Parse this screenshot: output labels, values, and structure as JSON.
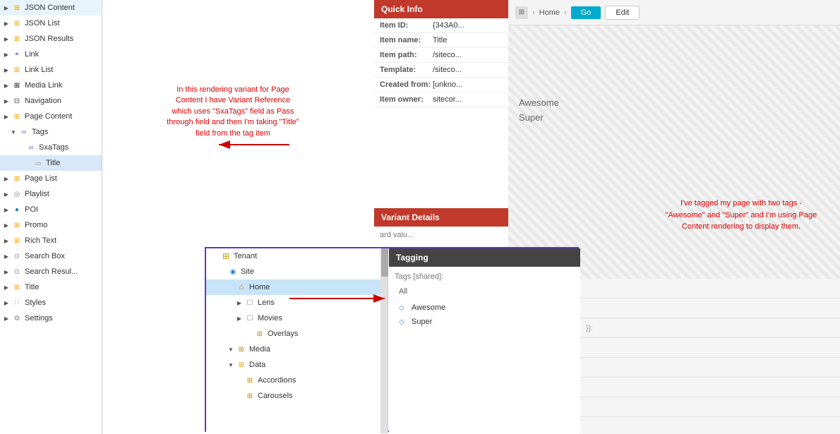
{
  "leftPanel": {
    "items": [
      {
        "id": "json-content",
        "label": "JSON Content",
        "icon": "⊞",
        "indent": 0,
        "hasArrow": true
      },
      {
        "id": "json-list",
        "label": "JSON List",
        "icon": "⊞",
        "indent": 0,
        "hasArrow": true
      },
      {
        "id": "json-results",
        "label": "JSON Results",
        "icon": "⊞",
        "indent": 0,
        "hasArrow": true
      },
      {
        "id": "link",
        "label": "Link",
        "icon": "⚭",
        "indent": 0,
        "hasArrow": true
      },
      {
        "id": "link-list",
        "label": "Link List",
        "icon": "⊞",
        "indent": 0,
        "hasArrow": true
      },
      {
        "id": "media-link",
        "label": "Media Link",
        "icon": "⊞",
        "indent": 0,
        "hasArrow": true
      },
      {
        "id": "navigation",
        "label": "Navigation",
        "icon": "⊟",
        "indent": 0,
        "hasArrow": true
      },
      {
        "id": "page-content",
        "label": "Page Content",
        "icon": "⊞",
        "indent": 0,
        "hasArrow": true
      },
      {
        "id": "tags",
        "label": "Tags",
        "icon": "∞",
        "indent": 1,
        "hasArrow": true,
        "isSelected": false
      },
      {
        "id": "sxatags",
        "label": "SxaTags",
        "icon": "∞",
        "indent": 2,
        "hasArrow": false
      },
      {
        "id": "title-child",
        "label": "Title",
        "icon": "▭",
        "indent": 3,
        "hasArrow": false
      },
      {
        "id": "page-list",
        "label": "Page List",
        "icon": "⊞",
        "indent": 0,
        "hasArrow": true
      },
      {
        "id": "playlist",
        "label": "Playlist",
        "icon": "◎",
        "indent": 0,
        "hasArrow": true
      },
      {
        "id": "poi",
        "label": "POI",
        "icon": "●",
        "indent": 0,
        "hasArrow": true
      },
      {
        "id": "promo",
        "label": "Promo",
        "icon": "⊞",
        "indent": 0,
        "hasArrow": true
      },
      {
        "id": "rich-text",
        "label": "Rich Text",
        "icon": "⊞",
        "indent": 0,
        "hasArrow": true
      },
      {
        "id": "search-box",
        "label": "Search Box",
        "icon": "⊙",
        "indent": 0,
        "hasArrow": true
      },
      {
        "id": "search-results",
        "label": "Search Resul...",
        "icon": "⊙",
        "indent": 0,
        "hasArrow": true
      },
      {
        "id": "title",
        "label": "Title",
        "icon": "⊞",
        "indent": 0,
        "hasArrow": true
      },
      {
        "id": "styles",
        "label": "Styles",
        "icon": "∷",
        "indent": 0,
        "hasArrow": true
      },
      {
        "id": "settings",
        "label": "Settings",
        "icon": "⚙",
        "indent": 0,
        "hasArrow": true
      }
    ]
  },
  "annotation": {
    "text": "In this rendering variant for Page Content I have Variant Reference which uses \"SxaTags\" field as Pass through field and then I'm taking \"Title\" field from the tag item"
  },
  "overlayTree": {
    "items": [
      {
        "id": "tenant",
        "label": "Tenant",
        "icon": "⊞",
        "indent": 0,
        "hasArrow": false
      },
      {
        "id": "site",
        "label": "Site",
        "icon": "◉",
        "indent": 1,
        "hasArrow": false
      },
      {
        "id": "home",
        "label": "Home",
        "icon": "⌂",
        "indent": 2,
        "hasArrow": false,
        "isSelected": true
      },
      {
        "id": "lens",
        "label": "Lens",
        "icon": "☐",
        "indent": 3,
        "hasArrow": true
      },
      {
        "id": "movies",
        "label": "Movies",
        "icon": "☐",
        "indent": 3,
        "hasArrow": true
      },
      {
        "id": "overlays",
        "label": "Overlays",
        "icon": "⊞",
        "indent": 4,
        "hasArrow": false
      },
      {
        "id": "media",
        "label": "Media",
        "icon": "⊞",
        "indent": 2,
        "hasArrow": true
      },
      {
        "id": "data",
        "label": "Data",
        "icon": "⊞",
        "indent": 2,
        "hasArrow": true
      },
      {
        "id": "accordions",
        "label": "Accordions",
        "icon": "⊞",
        "indent": 3,
        "hasArrow": false
      },
      {
        "id": "carousels",
        "label": "Carousels",
        "icon": "⊞",
        "indent": 3,
        "hasArrow": false
      }
    ]
  },
  "tagging": {
    "header": "Tagging",
    "label": "Tags",
    "labelSuffix": "[shared]:",
    "allText": "All",
    "tags": [
      {
        "label": "Awesome",
        "icon": "◇"
      },
      {
        "label": "Super",
        "icon": "◇"
      }
    ]
  },
  "quickInfo": {
    "header": "Quick Info",
    "rows": [
      {
        "key": "Item ID:",
        "value": "{343A0..."
      },
      {
        "key": "Item name:",
        "value": "Title"
      },
      {
        "key": "Item path:",
        "value": "/siteco..."
      },
      {
        "key": "Template:",
        "value": "/siteco..."
      },
      {
        "key": "Created from:",
        "value": "[unkno..."
      },
      {
        "key": "Item owner:",
        "value": "sitecor..."
      }
    ]
  },
  "variantDetails": {
    "header": "Variant Details",
    "valueLabel": "ard valu..."
  },
  "topBar": {
    "icon": "⊞",
    "homePath": "Home",
    "goLabel": "Go",
    "editLabel": "Edit"
  },
  "preview": {
    "label1": "Awesome",
    "label2": "Super"
  },
  "rightAnnotation": {
    "text": "I've tagged my page with two tags - \"Awesome\" and \"Super\" and I'm using Page Content rendering to display them."
  },
  "bottomRows": [
    {
      "text": ""
    },
    {
      "text": ""
    },
    {
      "text": ""
    },
    {
      "text": ""
    },
    {
      "text": "}]:"
    },
    {
      "text": ""
    },
    {
      "text": ""
    },
    {
      "text": ""
    }
  ]
}
